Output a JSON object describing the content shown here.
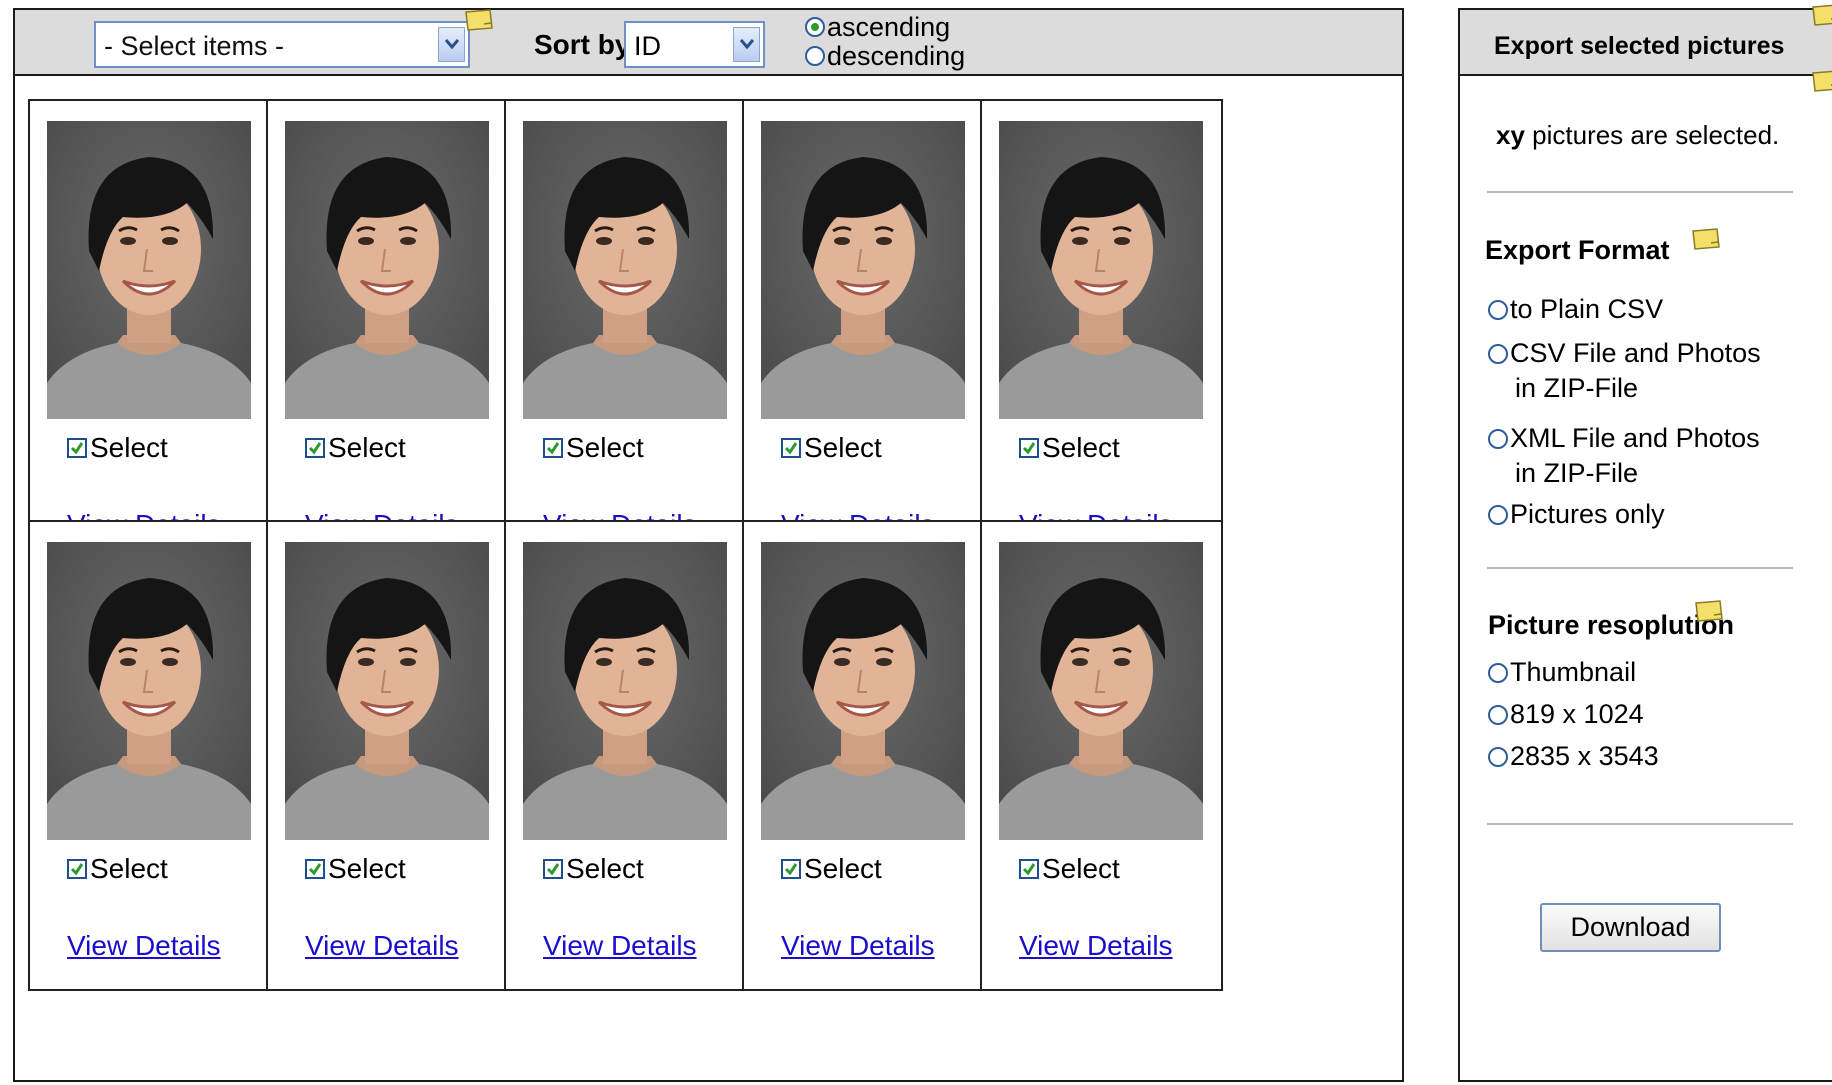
{
  "toolbar": {
    "select_placeholder": "- Select items -",
    "sort_label": "Sort by",
    "sort_value": "ID",
    "ascending_label": "ascending",
    "descending_label": "descending",
    "order_selected": "ascending"
  },
  "cards": [
    {
      "select_label": "Select",
      "selected": true,
      "details_label": "View Details"
    },
    {
      "select_label": "Select",
      "selected": true,
      "details_label": "View Details"
    },
    {
      "select_label": "Select",
      "selected": true,
      "details_label": "View Details"
    },
    {
      "select_label": "Select",
      "selected": true,
      "details_label": "View Details"
    },
    {
      "select_label": "Select",
      "selected": true,
      "details_label": "View Details"
    },
    {
      "select_label": "Select",
      "selected": true,
      "details_label": "View Details"
    },
    {
      "select_label": "Select",
      "selected": true,
      "details_label": "View Details"
    },
    {
      "select_label": "Select",
      "selected": true,
      "details_label": "View Details"
    },
    {
      "select_label": "Select",
      "selected": true,
      "details_label": "View Details"
    },
    {
      "select_label": "Select",
      "selected": true,
      "details_label": "View Details"
    }
  ],
  "export": {
    "title": "Export selected pictures",
    "count_prefix": "xy",
    "count_suffix": " pictures are selected.",
    "format_title": "Export Format",
    "format_options": [
      {
        "line1": "to Plain CSV",
        "line2": ""
      },
      {
        "line1": "CSV File and Photos",
        "line2": "in ZIP-File"
      },
      {
        "line1": "XML File and Photos",
        "line2": "in ZIP-File"
      },
      {
        "line1": "Pictures only",
        "line2": ""
      }
    ],
    "resolution_title": "Picture resoplution",
    "resolution_options": [
      "Thumbnail",
      "819 x 1024",
      "2835 x 3543"
    ],
    "download_label": "Download"
  },
  "colors": {
    "toolbar_bg": "#dcdcdc",
    "link": "#1a0dcc",
    "check": "#2e9a2e",
    "note": "#f3df6a"
  },
  "icons": [
    "dropdown-arrow-icon",
    "sticky-note-icon",
    "checkmark-icon",
    "portrait-photo"
  ]
}
